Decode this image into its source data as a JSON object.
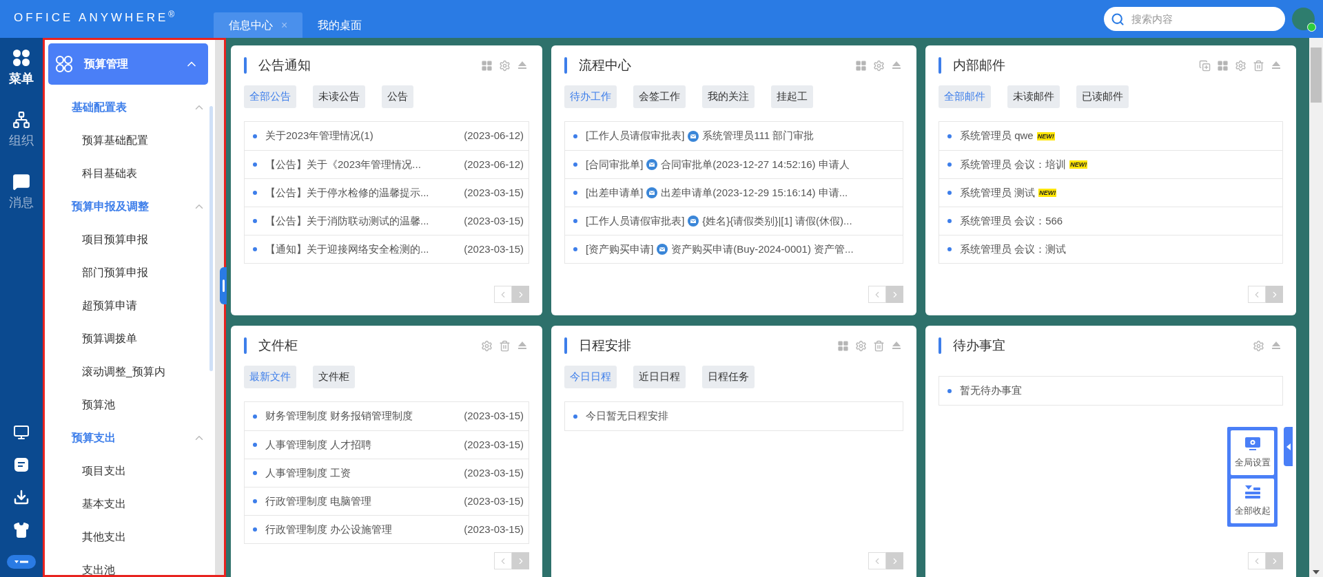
{
  "header": {
    "logo": "OFFICE ANYWHERE",
    "logo_mark": "®",
    "tabs": [
      {
        "label": "信息中心",
        "selected": true,
        "close": "×"
      },
      {
        "label": "我的桌面",
        "selected": false
      }
    ],
    "search": {
      "placeholder": "搜索内容"
    },
    "user": {
      "online": true
    }
  },
  "rail": {
    "items": [
      {
        "label": "菜单",
        "selected": true
      },
      {
        "label": "组织",
        "selected": false
      },
      {
        "label": "消息",
        "selected": false
      }
    ]
  },
  "sidebar": {
    "title": "预算管理",
    "expanded": true,
    "groups": [
      {
        "label": "基础配置表",
        "expanded": true,
        "children": [
          {
            "label": "预算基础配置"
          },
          {
            "label": "科目基础表"
          }
        ]
      },
      {
        "label": "预算申报及调整",
        "expanded": true,
        "children": [
          {
            "label": "项目预算申报"
          },
          {
            "label": "部门预算申报"
          },
          {
            "label": "超预算申请"
          },
          {
            "label": "预算调拨单"
          },
          {
            "label": "滚动调整_预算内"
          },
          {
            "label": "预算池"
          }
        ]
      },
      {
        "label": "预算支出",
        "expanded": true,
        "children": [
          {
            "label": "项目支出"
          },
          {
            "label": "基本支出"
          },
          {
            "label": "其他支出"
          },
          {
            "label": "支出池"
          }
        ]
      }
    ]
  },
  "panels": [
    {
      "title": "公告通知",
      "tools": [
        {
          "kind": "layout"
        },
        {
          "kind": "settings"
        },
        {
          "kind": "collapse"
        }
      ],
      "tabs": [
        {
          "label": "全部公告",
          "selected": true
        },
        {
          "label": "未读公告",
          "selected": false
        },
        {
          "label": "公告",
          "selected": false
        }
      ],
      "items": [
        {
          "text": "关于2023年管理情况(1)",
          "date": "(2023-06-12)"
        },
        {
          "text": "【公告】关于《2023年管理情况...",
          "date": "(2023-06-12)"
        },
        {
          "text": "【公告】关于停水检修的温馨提示...",
          "date": "(2023-03-15)"
        },
        {
          "text": "【公告】关于消防联动测试的温馨...",
          "date": "(2023-03-15)"
        },
        {
          "text": "【通知】关于迎接网络安全检测的...",
          "date": "(2023-03-15)"
        }
      ]
    },
    {
      "title": "流程中心",
      "tools": [
        {
          "kind": "layout"
        },
        {
          "kind": "settings"
        },
        {
          "kind": "collapse"
        }
      ],
      "tabs": [
        {
          "label": "待办工作",
          "selected": true
        },
        {
          "label": "会签工作",
          "selected": false
        },
        {
          "label": "我的关注",
          "selected": false
        },
        {
          "label": "挂起工",
          "selected": false
        }
      ],
      "items": [
        {
          "form": "[工作人员请假审批表]",
          "text": "系统管理员111 部门审批"
        },
        {
          "form": "[合同审批单]",
          "text": "合同审批单(2023-12-27 14:52:16) 申请人"
        },
        {
          "form": "[出差申请单]",
          "text": "出差申请单(2023-12-29 15:16:14) 申请..."
        },
        {
          "form": "[工作人员请假审批表]",
          "text": "{姓名}{请假类别}|[1] 请假(休假)..."
        },
        {
          "form": "[资产购买申请]",
          "text": "资产购买申请(Buy-2024-0001) 资产管..."
        }
      ]
    },
    {
      "title": "内部邮件",
      "tools": [
        {
          "kind": "copy"
        },
        {
          "kind": "layout"
        },
        {
          "kind": "settings"
        },
        {
          "kind": "delete"
        },
        {
          "kind": "collapse"
        }
      ],
      "tabs": [
        {
          "label": "全部邮件",
          "selected": true
        },
        {
          "label": "未读邮件",
          "selected": false
        },
        {
          "label": "已读邮件",
          "selected": false
        }
      ],
      "items": [
        {
          "text": "系统管理员 qwe",
          "badge": "NEW!"
        },
        {
          "text": "系统管理员 会议：培训",
          "badge": "NEW!"
        },
        {
          "text": "系统管理员 测试",
          "badge": "NEW!"
        },
        {
          "text": "系统管理员 会议：566"
        },
        {
          "text": "系统管理员 会议：测试"
        }
      ]
    },
    {
      "title": "文件柜",
      "tools": [
        {
          "kind": "settings"
        },
        {
          "kind": "delete"
        },
        {
          "kind": "collapse"
        }
      ],
      "tabs": [
        {
          "label": "最新文件",
          "selected": true
        },
        {
          "label": "文件柜",
          "selected": false
        }
      ],
      "items": [
        {
          "text": "财务管理制度 财务报销管理制度",
          "date": "(2023-03-15)"
        },
        {
          "text": "人事管理制度 人才招聘",
          "date": "(2023-03-15)"
        },
        {
          "text": "人事管理制度 工资",
          "date": "(2023-03-15)"
        },
        {
          "text": "行政管理制度 电脑管理",
          "date": "(2023-03-15)"
        },
        {
          "text": "行政管理制度 办公设施管理",
          "date": "(2023-03-15)"
        }
      ]
    },
    {
      "title": "日程安排",
      "tools": [
        {
          "kind": "layout"
        },
        {
          "kind": "settings"
        },
        {
          "kind": "delete"
        },
        {
          "kind": "collapse"
        }
      ],
      "tabs": [
        {
          "label": "今日日程",
          "selected": true
        },
        {
          "label": "近日日程",
          "selected": false
        },
        {
          "label": "日程任务",
          "selected": false
        }
      ],
      "items": [
        {
          "text": "今日暂无日程安排"
        }
      ]
    },
    {
      "title": "待办事宜",
      "tools": [
        {
          "kind": "settings"
        },
        {
          "kind": "collapse"
        }
      ],
      "items": [
        {
          "text": "暂无待办事宜"
        }
      ]
    }
  ],
  "float_panel": [
    {
      "kind": "settings",
      "label": "全局设置"
    },
    {
      "kind": "collapse",
      "label": "全部收起"
    }
  ]
}
